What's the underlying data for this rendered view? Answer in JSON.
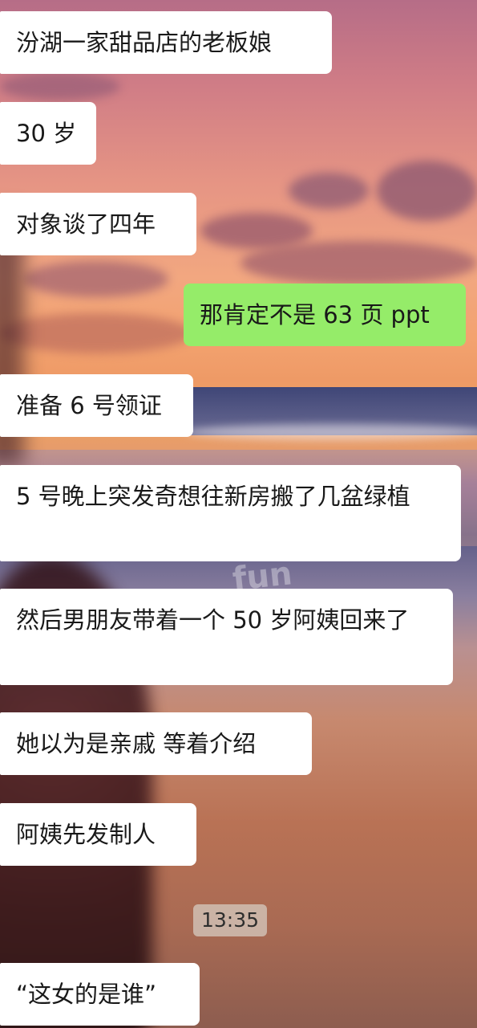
{
  "chat": {
    "messages": [
      {
        "side": "received",
        "text": "汾湖一家甜品店的老板娘"
      },
      {
        "side": "received",
        "text": "30 岁"
      },
      {
        "side": "received",
        "text": "对象谈了四年"
      },
      {
        "side": "sent",
        "text": "那肯定不是 63 页 ppt"
      },
      {
        "side": "received",
        "text": "准备 6 号领证"
      },
      {
        "side": "received",
        "text": "5 号晚上突发奇想往新房搬了几盆绿植"
      },
      {
        "side": "received",
        "text": "然后男朋友带着一个 50 岁阿姨回来了"
      },
      {
        "side": "received",
        "text": "她以为是亲戚 等着介绍"
      },
      {
        "side": "received",
        "text": "阿姨先发制人"
      },
      {
        "side": "received",
        "text": "“这女的是谁”"
      }
    ],
    "timestamp": "13:35"
  },
  "colors": {
    "received_bubble": "#ffffff",
    "sent_bubble": "#95ec69",
    "timestamp_bg": "#d6cbc0"
  }
}
